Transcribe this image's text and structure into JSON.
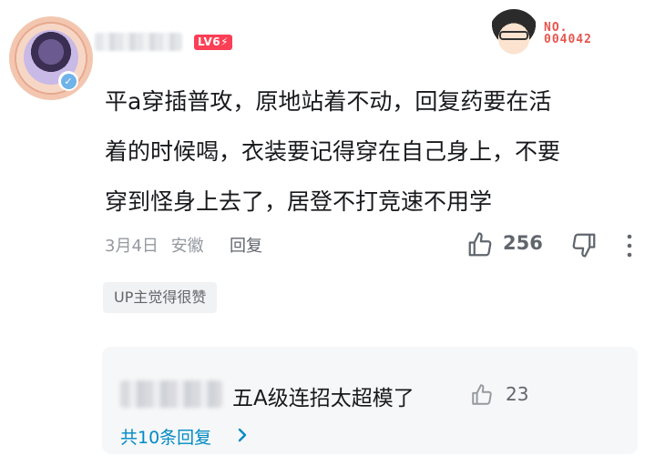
{
  "comment": {
    "author": {
      "level": "LV6",
      "level_suffix": "⚡"
    },
    "fan_badge": {
      "label_line1": "NO.",
      "label_line2": "004042"
    },
    "text_lines": [
      "平a穿插普攻，原地站着不动，回复药要在活",
      "着的时候喝，衣装要记得穿在自己身上，不要",
      "穿到怪身上去了，居登不打竞速不用学"
    ],
    "date": "3月4日",
    "location": "安徽",
    "reply_label": "回复",
    "like_count": "256",
    "tag": "UP主觉得很赞"
  },
  "replies": {
    "first_reply_text": "五A级连招太超模了",
    "first_reply_likes": "23",
    "more_label": "共10条回复"
  },
  "icons": {
    "like": "thumbs-up-icon",
    "dislike": "thumbs-down-icon",
    "more": "more-vertical-icon",
    "chevron": "chevron-right-icon"
  },
  "colors": {
    "level_badge": "#fb3f55",
    "link_blue": "#008ac5",
    "fan_badge_red": "#e8554f"
  }
}
